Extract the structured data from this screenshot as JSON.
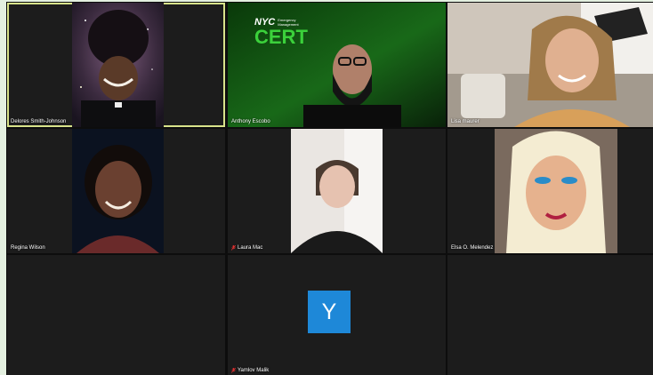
{
  "meeting": {
    "participants": [
      {
        "name": "Delores Smith-Johnson",
        "muted": false,
        "active_speaker": true
      },
      {
        "name": "Anthony Escobo",
        "muted": false,
        "active_speaker": false
      },
      {
        "name": "Lisa maurer",
        "muted": false,
        "active_speaker": false
      },
      {
        "name": "Regina Wilson",
        "muted": false,
        "active_speaker": false
      },
      {
        "name": "Laura Mac",
        "muted": true,
        "active_speaker": false
      },
      {
        "name": "Elsa O. Melendez",
        "muted": false,
        "active_speaker": false
      },
      {
        "name": "Yamlov Malik",
        "muted": true,
        "active_speaker": false,
        "avatar_initial": "Y"
      }
    ],
    "background_logo": {
      "line1": "NYC",
      "line2": "Emergency",
      "line3": "Management",
      "big": "CERT"
    }
  },
  "colors": {
    "active_border": "#d8e38a",
    "avatar_bg": "#1e88d8",
    "muted_icon": "#e03030",
    "cert_green": "#3bd13b"
  }
}
